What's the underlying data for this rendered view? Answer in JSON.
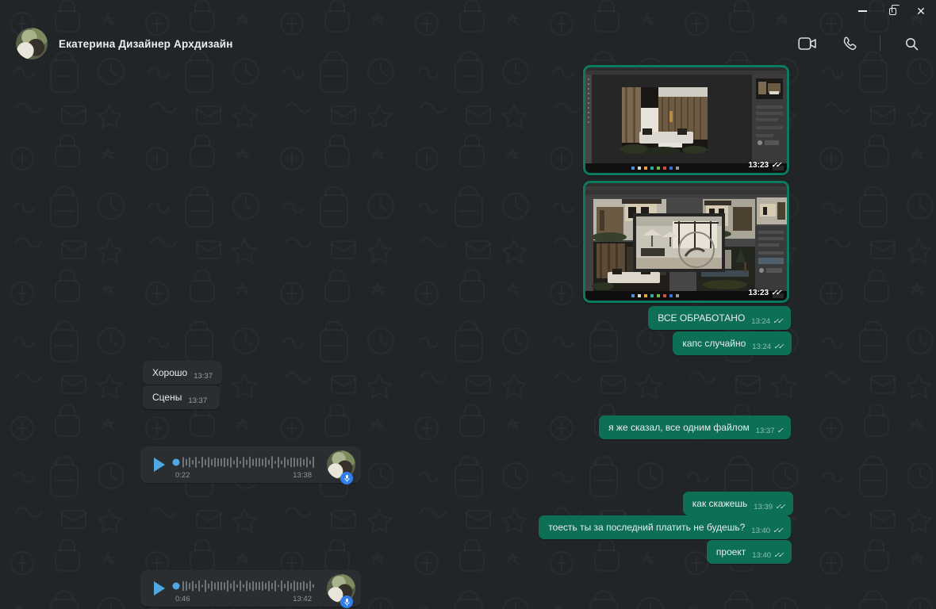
{
  "window": {
    "controls": {
      "minimize": "–",
      "restore": "restore",
      "close": "✕"
    }
  },
  "header": {
    "contact_name": "Екатерина Дизайнер Архдизайн",
    "icons": [
      "video-call",
      "voice-call",
      "search"
    ]
  },
  "colors": {
    "background": "#222527",
    "outgoing_bubble": "#0d6f56",
    "incoming_bubble": "#2b2e30",
    "image_frame_green": "#0c7a60",
    "voice_accent_blue": "#4fa7e3",
    "mic_badge_blue": "#2f80ea"
  },
  "messages": [
    {
      "type": "image",
      "direction": "out",
      "description": "Photoshop screenshot — interior render with wood wall and white sofa",
      "time": "13:23",
      "ticks": "✓✓"
    },
    {
      "type": "image",
      "direction": "out",
      "description": "Photoshop screenshot — collage of exterior house renders",
      "time": "13:23",
      "ticks": "✓✓"
    },
    {
      "type": "text",
      "direction": "out",
      "text": "ВСЕ ОБРАБОТАНО",
      "time": "13:24",
      "ticks": "✓✓"
    },
    {
      "type": "text",
      "direction": "out",
      "text": "капс случайно",
      "time": "13:24",
      "ticks": "✓✓"
    },
    {
      "type": "text",
      "direction": "in",
      "text": "Хорошо",
      "time": "13:37"
    },
    {
      "type": "text",
      "direction": "in",
      "text": "Сцены",
      "time": "13:37"
    },
    {
      "type": "text",
      "direction": "out",
      "text": "я же сказал, все одним файлом",
      "time": "13:37",
      "ticks": "✓"
    },
    {
      "type": "voice",
      "direction": "in",
      "duration": "0:22",
      "time": "13:38"
    },
    {
      "type": "text",
      "direction": "out",
      "text": "как скажешь",
      "time": "13:39",
      "ticks": "✓✓"
    },
    {
      "type": "text",
      "direction": "out",
      "text": "тоесть ты за последний платить не будешь?",
      "time": "13:40",
      "ticks": "✓✓"
    },
    {
      "type": "text",
      "direction": "out",
      "text": "проект",
      "time": "13:40",
      "ticks": "✓✓"
    },
    {
      "type": "voice",
      "direction": "in",
      "duration": "0:46",
      "time": "13:42"
    }
  ]
}
